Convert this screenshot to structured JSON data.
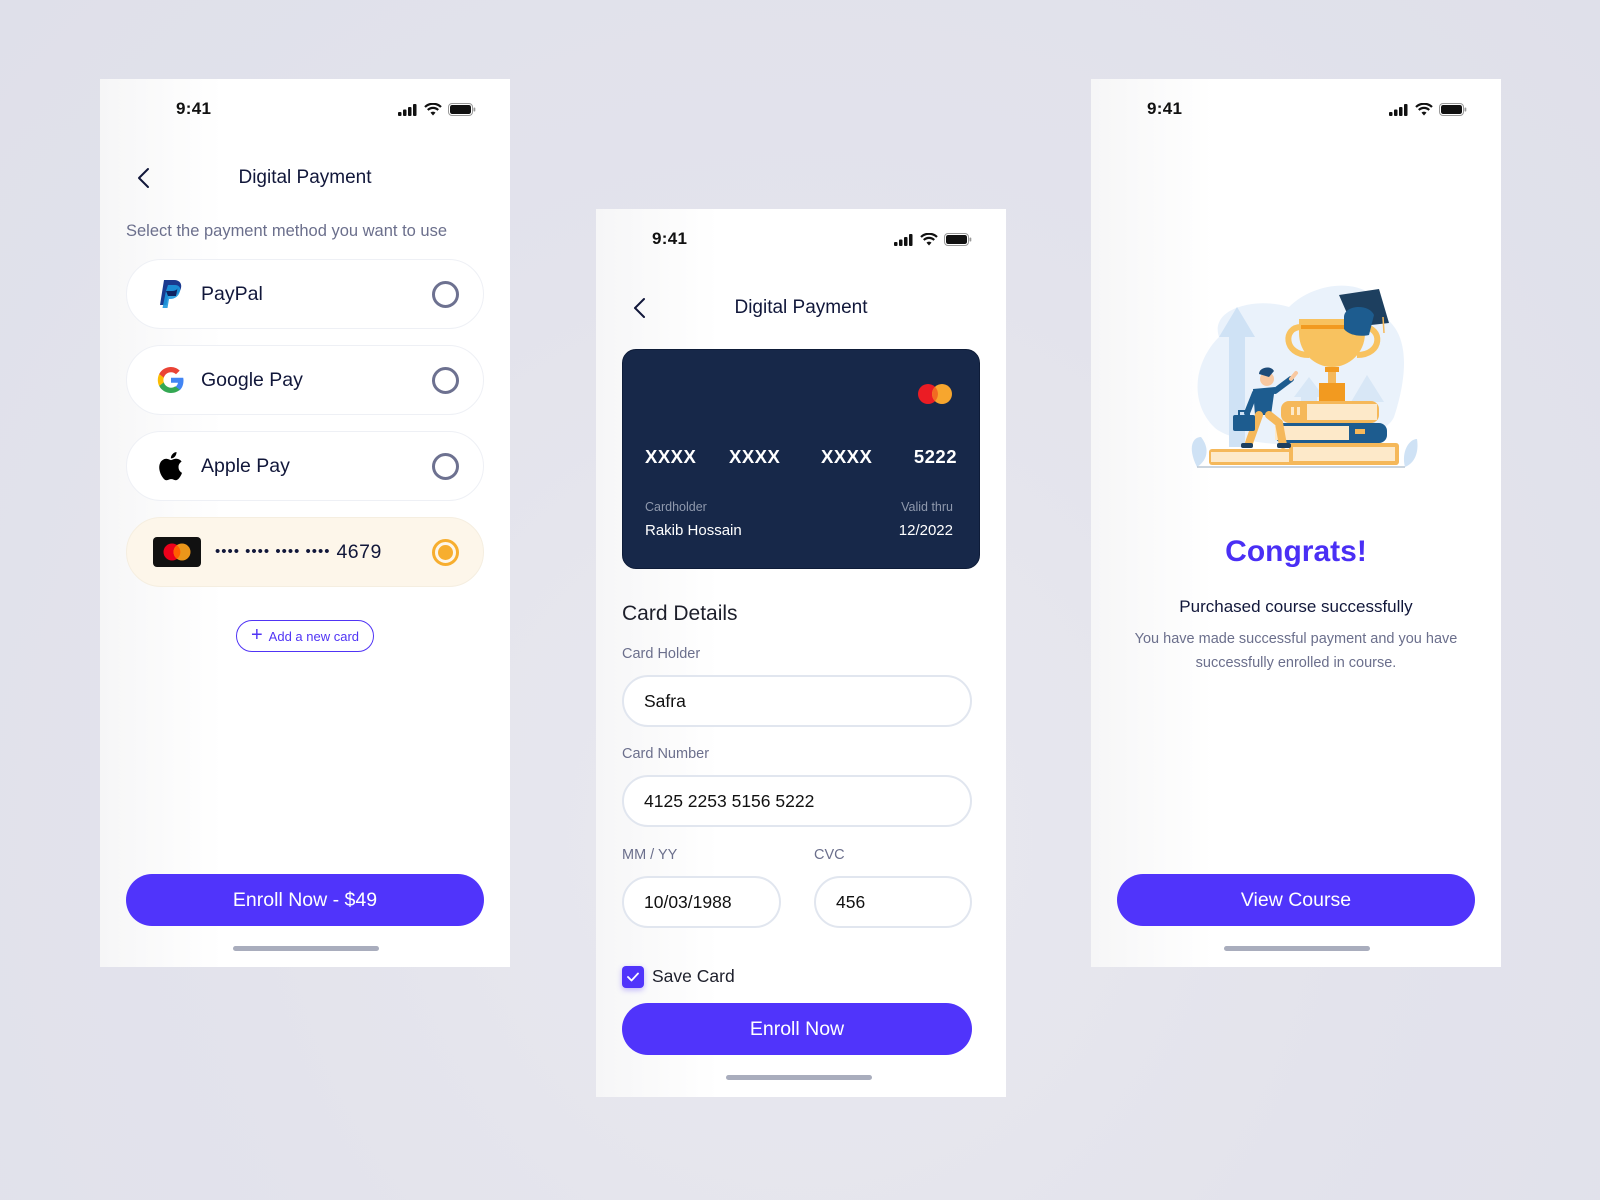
{
  "colors": {
    "primary": "#5034fb",
    "selected_bg": "#fdf6ea",
    "selected_radio": "#f7ae2f",
    "card_bg": "#172849",
    "heading": "#11173a",
    "muted": "#6b6f8c"
  },
  "screens": {
    "payment_methods": {
      "status": {
        "time": "9:41",
        "icons": [
          "cellular-signal-icon",
          "wifi-icon",
          "battery-icon"
        ]
      },
      "nav": {
        "back_icon": "chevron-left-icon",
        "title": "Digital Payment"
      },
      "subtitle": "Select the payment method you want to use",
      "methods": [
        {
          "label": "PayPal",
          "icon": "paypal-icon",
          "selected": false
        },
        {
          "label": "Google Pay",
          "icon": "google-icon",
          "selected": false
        },
        {
          "label": "Apple Pay",
          "icon": "apple-icon",
          "selected": false
        }
      ],
      "saved_card": {
        "icon": "mastercard-icon",
        "masked": "•••• •••• •••• ••••",
        "last4": "4679",
        "selected": true
      },
      "add_card_label": "Add a new card",
      "cta_label": "Enroll Now - $49"
    },
    "card_details": {
      "status": {
        "time": "9:41"
      },
      "nav": {
        "title": "Digital Payment"
      },
      "card": {
        "groups": [
          "XXXX",
          "XXXX",
          "XXXX",
          "5222"
        ],
        "holder_label": "Cardholder",
        "holder_name": "Rakib Hossain",
        "valid_label": "Valid thru",
        "valid_value": "12/2022"
      },
      "section_title": "Card Details",
      "fields": {
        "card_holder": {
          "label": "Card Holder",
          "value": "Safra"
        },
        "card_number": {
          "label": "Card Number",
          "value": "4125 2253 5156 5222"
        },
        "expiry": {
          "label": "MM / YY",
          "value": "10/03/1988"
        },
        "cvc": {
          "label": "CVC",
          "value": "456"
        }
      },
      "save_card": {
        "label": "Save Card",
        "checked": true
      },
      "cta_label": "Enroll Now"
    },
    "success": {
      "status": {
        "time": "9:41"
      },
      "illustration": "trophy-graduation-illustration",
      "heading": "Congrats!",
      "title": "Purchased course successfully",
      "description": "You have made successful payment and you have successfully enrolled in course.",
      "cta_label": "View Course"
    }
  }
}
